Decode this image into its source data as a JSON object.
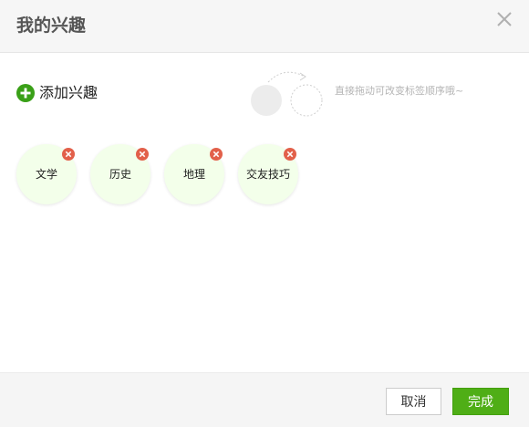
{
  "dialog": {
    "title": "我的兴趣",
    "close_icon": "close-icon"
  },
  "add_interest": {
    "label": "添加兴趣",
    "icon": "plus-circle-icon",
    "icon_color": "#3aa018"
  },
  "hint": {
    "text": "直接拖动可改变标签顺序哦~"
  },
  "tags": [
    {
      "label": "文学"
    },
    {
      "label": "历史"
    },
    {
      "label": "地理"
    },
    {
      "label": "交友技巧"
    }
  ],
  "tag_style": {
    "background": "#f3ffea",
    "remove_icon": "remove-x-icon",
    "remove_color": "#e2604a"
  },
  "footer": {
    "cancel_label": "取消",
    "done_label": "完成",
    "done_color": "#4fae16"
  }
}
